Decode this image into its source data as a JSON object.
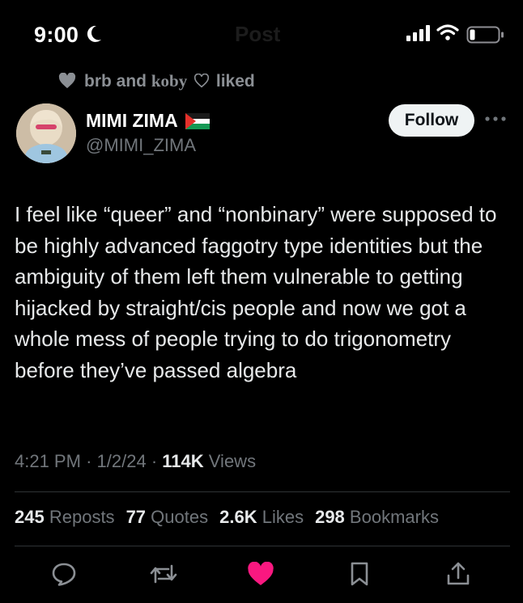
{
  "status_bar": {
    "time": "9:00",
    "title_faded": "Post"
  },
  "social_context": {
    "part1": "brb and",
    "part2": "koby",
    "part3": "liked"
  },
  "author": {
    "display_name": "MIMI ZIMA",
    "handle": "@MIMI_ZIMA"
  },
  "follow_label": "Follow",
  "tweet": {
    "text": "I feel like “queer” and “nonbinary” were supposed to be highly advanced faggotry type identities but the ambiguity of them left them vulnerable to getting hijacked by straight/cis people and now we got a whole mess of people trying to do trigonometry before they’ve passed algebra"
  },
  "meta": {
    "time": "4:21 PM",
    "sep1": "·",
    "date": "1/2/24",
    "sep2": "·",
    "views_count": "114K",
    "views_label": "Views"
  },
  "stats": {
    "reposts_count": "245",
    "reposts_label": "Reposts",
    "quotes_count": "77",
    "quotes_label": "Quotes",
    "likes_count": "2.6K",
    "likes_label": "Likes",
    "bookmarks_count": "298",
    "bookmarks_label": "Bookmarks"
  },
  "colors": {
    "background": "#000000",
    "text": "#e7e9ea",
    "muted": "#71767b",
    "like": "#f91880",
    "divider": "#2f3336"
  },
  "icons": [
    "moon-icon",
    "signal-icon",
    "wifi-icon",
    "battery-icon",
    "heart-icon",
    "more-icon",
    "reply-icon",
    "repost-icon",
    "like-icon",
    "bookmark-icon",
    "share-icon"
  ]
}
